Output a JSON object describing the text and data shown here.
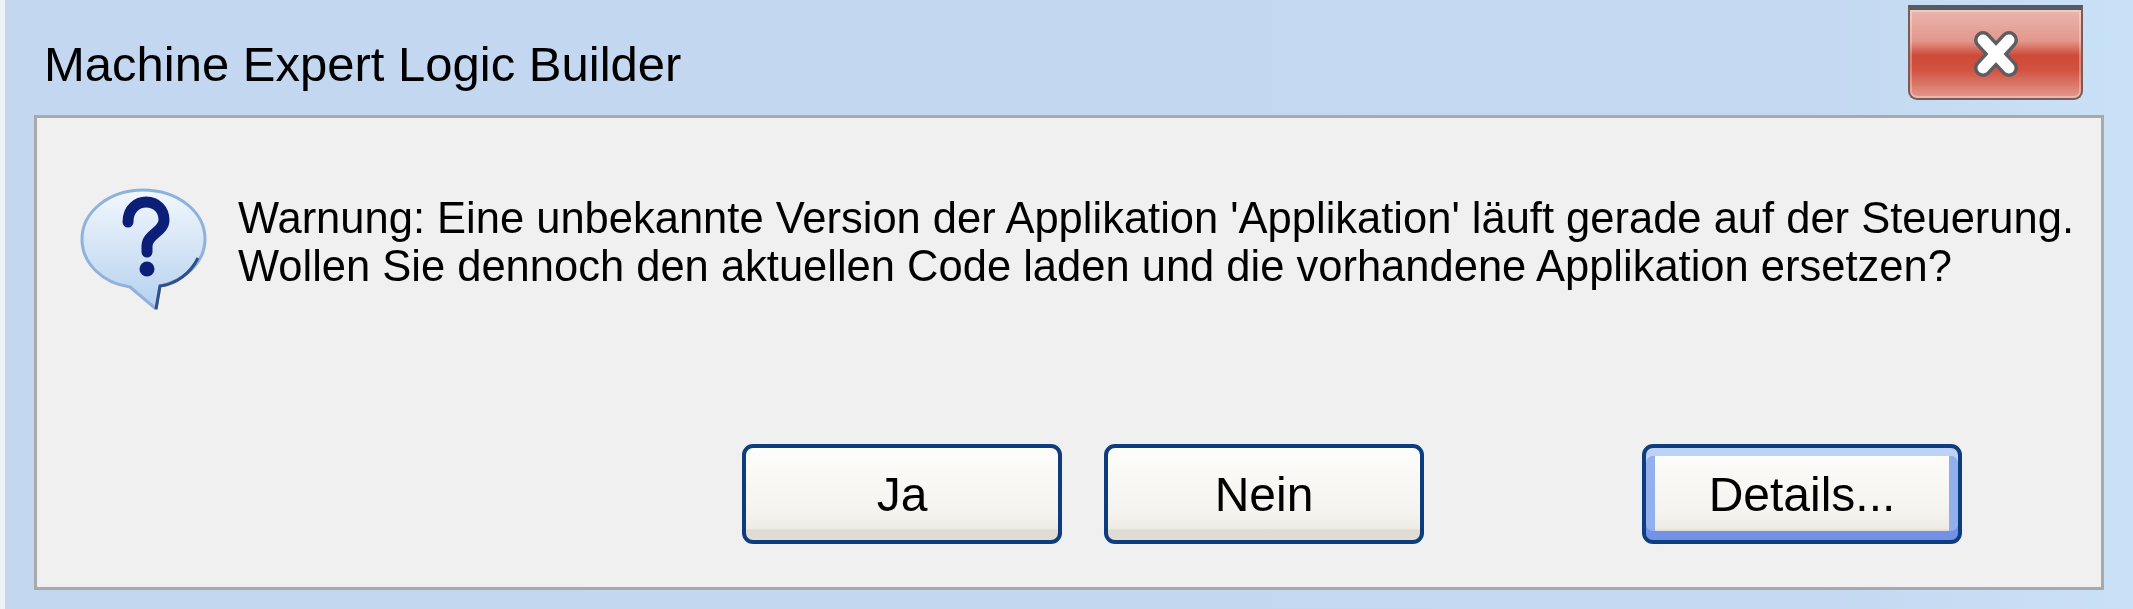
{
  "window": {
    "title": "Machine Expert Logic Builder"
  },
  "message": [
    "Warnung: Eine unbekannte Version der Applikation 'Applikation' läuft gerade auf der Steuerung.",
    "Wollen Sie dennoch den aktuellen Code laden und die vorhandene Applikation ersetzen?"
  ],
  "buttons": [
    {
      "label": "Ja",
      "default": false
    },
    {
      "label": "Nein",
      "default": false
    }
  ],
  "details_button": {
    "label": "Details...",
    "default": true
  }
}
